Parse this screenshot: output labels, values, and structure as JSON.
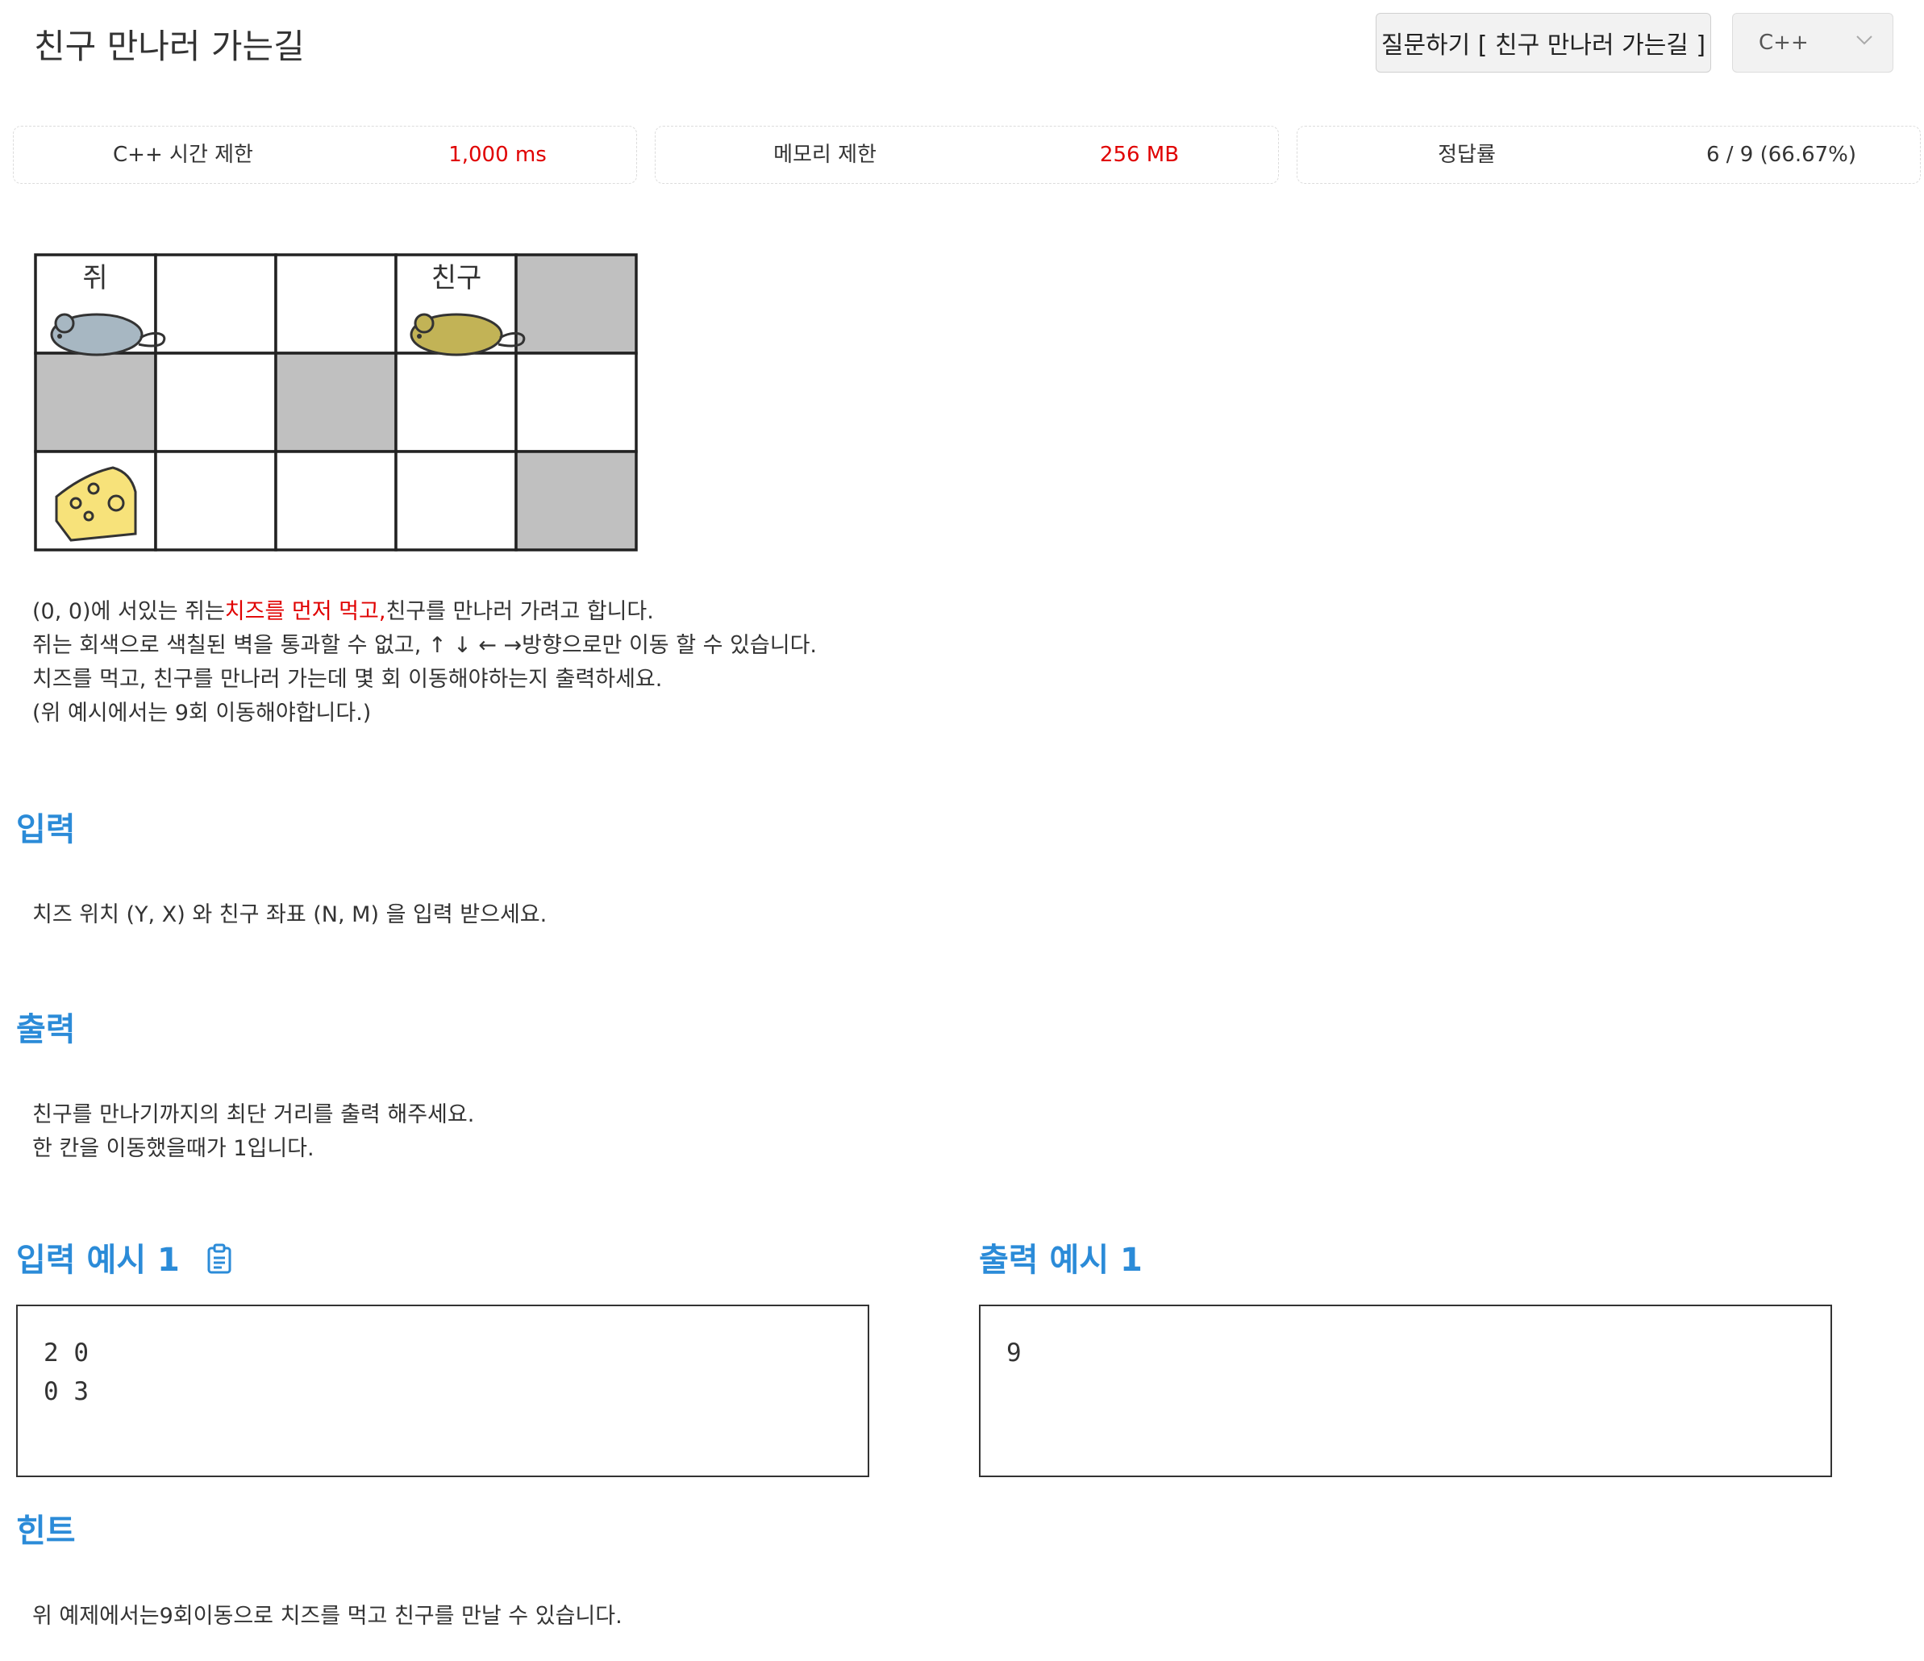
{
  "header": {
    "title": "친구 만나러 가는길",
    "ask_button": "질문하기 [ 친구 만나러 가는길 ]",
    "language": "C++"
  },
  "stats": [
    {
      "label": "C++ 시간 제한",
      "value": "1,000 ms"
    },
    {
      "label": "메모리 제한",
      "value": "256 MB"
    },
    {
      "label": "정답률",
      "value": "6 / 9 (66.67%)"
    }
  ],
  "figure": {
    "mouse_label": "쥐",
    "friend_label": "친구",
    "rows": 3,
    "cols": 5,
    "walls": [
      [
        0,
        4
      ],
      [
        1,
        0
      ],
      [
        1,
        2
      ],
      [
        2,
        4
      ]
    ],
    "mouse_pos": [
      0,
      0
    ],
    "friend_pos": [
      0,
      3
    ],
    "cheese_pos": [
      2,
      0
    ],
    "colors": {
      "wall": "#c0c0c0",
      "mouse": "#a7b7c2",
      "friend": "#c2b356",
      "cheese": "#f7e27a"
    }
  },
  "description": {
    "line1_before": "(0, 0)에 서있는 쥐는",
    "line1_highlight": "치즈를 먼저 먹고,",
    "line1_after": "친구를 만나러 가려고 합니다.",
    "line2": "쥐는 회색으로 색칠된 벽을 통과할 수 없고, ↑ ↓ ← →방향으로만 이동 할 수 있습니다.",
    "line3": "치즈를 먹고, 친구를 만나러 가는데 몇 회 이동해야하는지 출력하세요.",
    "line4": "(위 예시에서는 9회 이동해야합니다.)"
  },
  "input_section": {
    "heading": "입력",
    "text": "치즈 위치 (Y, X) 와 친구 좌표 (N, M) 을 입력 받으세요."
  },
  "output_section": {
    "heading": "출력",
    "line1": "친구를 만나기까지의 최단 거리를 출력 해주세요.",
    "line2": "한 칸을 이동했을때가 1입니다."
  },
  "examples": {
    "input_heading": "입력 예시 1",
    "output_heading": "출력 예시 1",
    "input_lines": [
      "2 0",
      "0 3"
    ],
    "output_lines": [
      "9"
    ]
  },
  "hint": {
    "heading": "힌트",
    "text": "위 예제에서는9회이동으로 치즈를 먹고 친구를 만날 수 있습니다."
  },
  "colors": {
    "accent": "#2b8bd8",
    "highlight": "#e00000"
  }
}
